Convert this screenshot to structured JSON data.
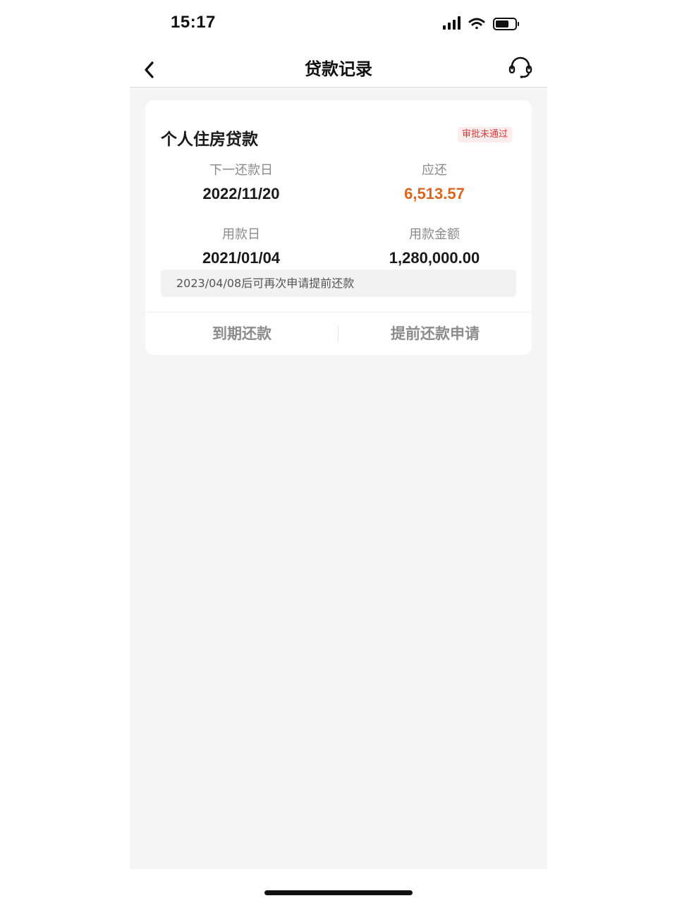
{
  "status_bar": {
    "time": "15:17",
    "icons": [
      "signal-icon",
      "wifi-icon",
      "battery-icon"
    ]
  },
  "nav": {
    "title": "贷款记录",
    "back_icon": "chevron-left-icon",
    "support_icon": "headset-icon"
  },
  "loan": {
    "title": "个人住房贷款",
    "status": "审批未通过",
    "next_payment_label": "下一还款日",
    "next_payment_date": "2022/11/20",
    "amount_due_label": "应还",
    "amount_due": "6,513.57",
    "disbursement_label": "用款日",
    "disbursement_date": "2021/01/04",
    "loan_amount_label": "用款金额",
    "loan_amount": "1,280,000.00",
    "notice": "2023/04/08后可再次申请提前还款",
    "actions": {
      "due_repayment": "到期还款",
      "early_repayment": "提前还款申请"
    }
  },
  "colors": {
    "accent": "#d9661f",
    "status_badge_text": "#d23b3b",
    "status_badge_bg": "#fdecec",
    "page_bg": "#f5f5f5"
  }
}
